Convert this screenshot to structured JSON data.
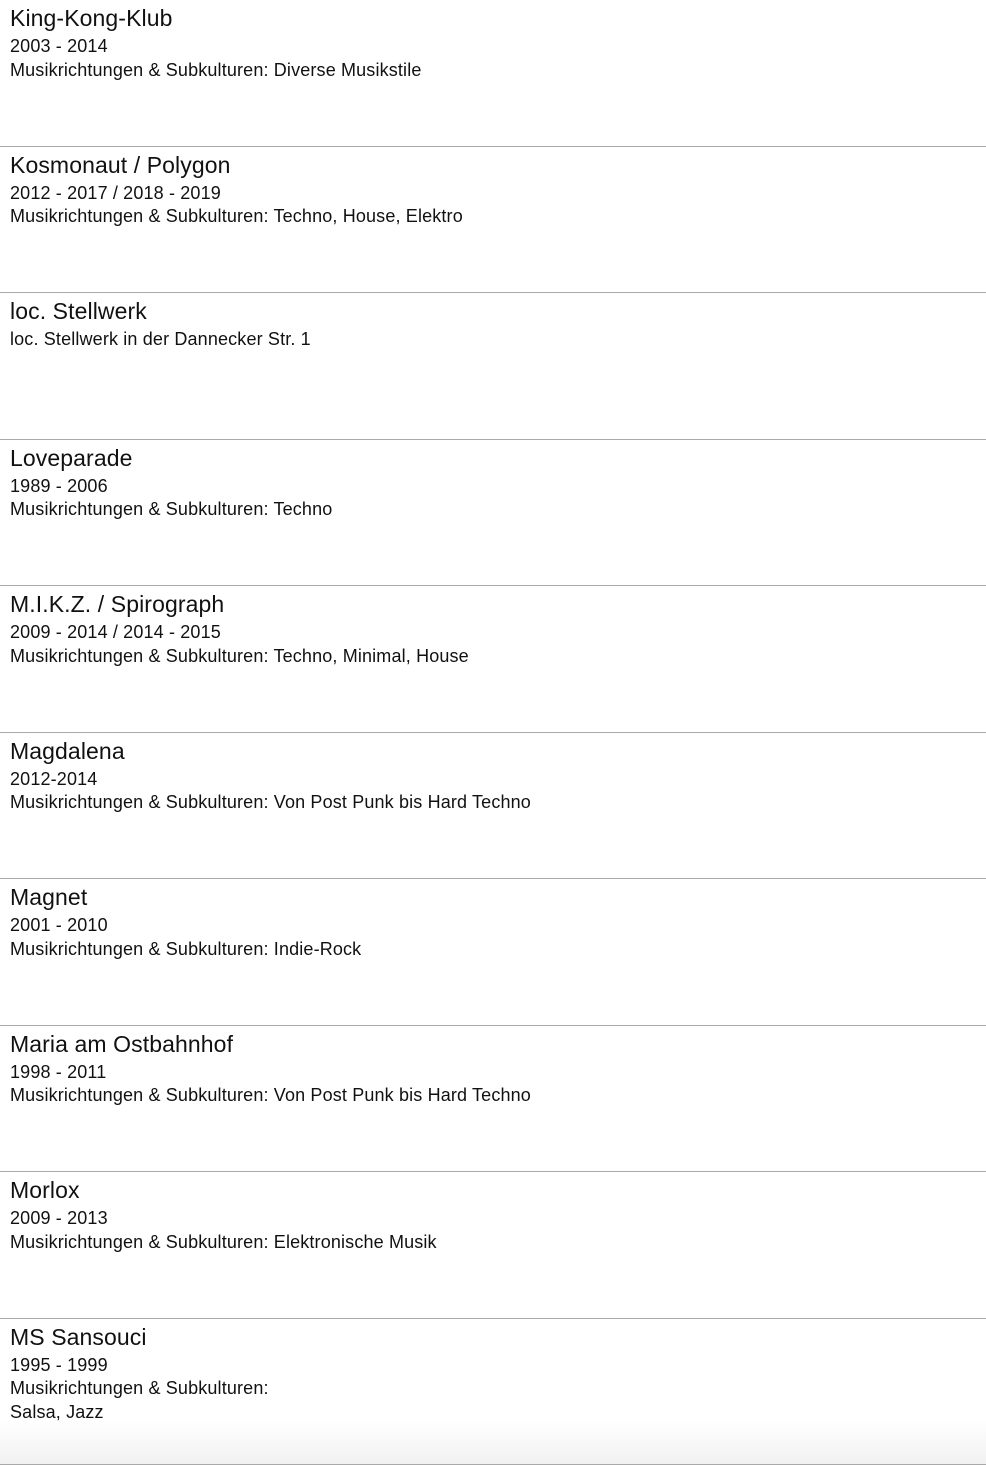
{
  "entries": [
    {
      "title": "King-Kong-Klub",
      "lines": [
        "2003 - 2014",
        "Musikrichtungen & Subkulturen: Diverse Musikstile"
      ]
    },
    {
      "title": "Kosmonaut / Polygon",
      "lines": [
        "2012 - 2017 / 2018 - 2019",
        "Musikrichtungen & Subkulturen: Techno, House, Elektro"
      ]
    },
    {
      "title": "loc. Stellwerk",
      "lines": [
        "loc. Stellwerk in der Dannecker Str. 1"
      ]
    },
    {
      "title": "Loveparade",
      "lines": [
        "1989 - 2006",
        "Musikrichtungen & Subkulturen: Techno"
      ]
    },
    {
      "title": "M.I.K.Z. / Spirograph",
      "lines": [
        "2009 - 2014 / 2014 - 2015",
        "Musikrichtungen & Subkulturen: Techno, Minimal, House"
      ]
    },
    {
      "title": "Magdalena",
      "lines": [
        "2012-2014",
        "Musikrichtungen & Subkulturen: Von Post Punk bis Hard Techno"
      ]
    },
    {
      "title": "Magnet",
      "lines": [
        "2001 - 2010",
        "Musikrichtungen & Subkulturen: Indie-Rock"
      ]
    },
    {
      "title": "Maria am Ostbahnhof",
      "lines": [
        "1998 - 2011",
        "Musikrichtungen & Subkulturen: Von Post Punk bis Hard Techno"
      ]
    },
    {
      "title": "Morlox",
      "lines": [
        "2009 - 2013",
        "Musikrichtungen & Subkulturen: Elektronische Musik"
      ]
    },
    {
      "title": "MS Sansouci",
      "lines": [
        "1995 - 1999",
        "Musikrichtungen & Subkulturen:",
        "Salsa, Jazz"
      ]
    }
  ]
}
